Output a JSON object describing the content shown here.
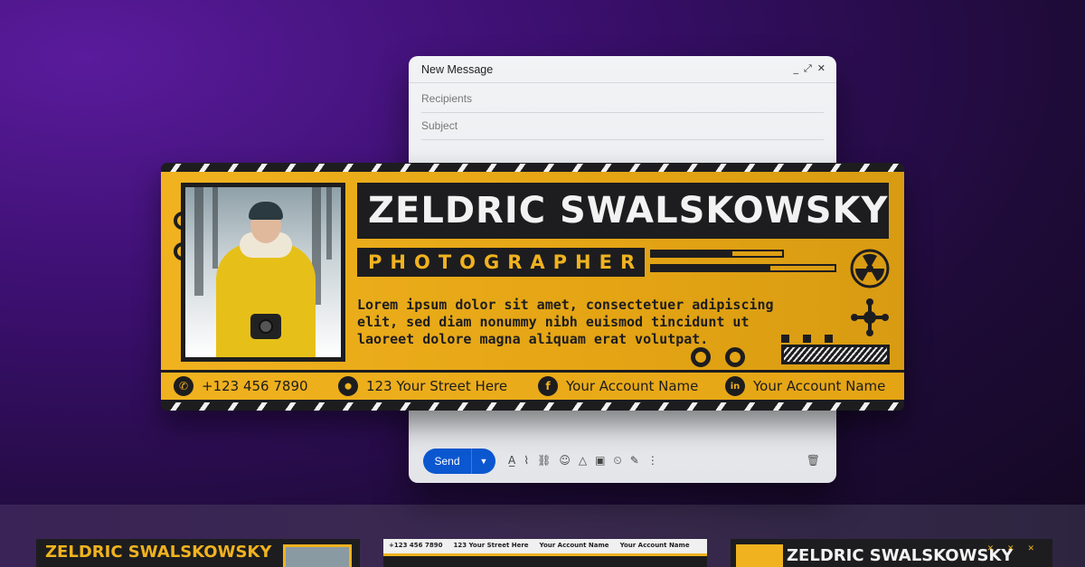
{
  "email": {
    "title": "New Message",
    "controls": [
      "_",
      "⤢",
      "✕"
    ],
    "recipients_placeholder": "Recipients",
    "subject_placeholder": "Subject",
    "send_label": "Send",
    "dropdown_icon": "▼",
    "toolbar_icons": [
      "format-text-icon",
      "attach-icon",
      "link-icon",
      "emoji-icon",
      "drive-icon",
      "image-icon",
      "lock-clock-icon",
      "pen-icon",
      "more-icon"
    ],
    "toolbar_glyphs": [
      "A̲",
      "⌇",
      "⛓",
      "☺",
      "△",
      "▣",
      "⏲",
      "✎",
      "⋮"
    ],
    "trash_glyph": "🗑"
  },
  "signature": {
    "name": "ZELDRIC SWALSKOWSKY",
    "role": "PHOTOGRAPHER",
    "description": "Lorem ipsum dolor sit amet, consectetuer adipiscing elit, sed diam nonummy nibh euismod tincidunt ut laoreet dolore magna aliquam erat volutpat.",
    "bars": [
      0.62,
      0.65
    ],
    "contacts": {
      "phone": "+123 456 7890",
      "address": "123 Your Street Here",
      "facebook": "Your Account Name",
      "linkedin": "Your Account Name"
    },
    "contact_glyphs": {
      "whatsapp": "✆",
      "location": "⬤",
      "facebook": "f",
      "linkedin": "in"
    },
    "colors": {
      "accent": "#f0b21f",
      "dark": "#1d1d1f",
      "light": "#f2f2f2"
    }
  },
  "thumbnails": {
    "first_name": "ZELDRIC SWALSKOWSKY",
    "second_phone": "+123 456 7890",
    "second_address": "123 Your Street Here",
    "second_facebook": "Your Account Name",
    "second_linkedin": "Your Account Name",
    "third_name": "ZELDRIC SWALSKOWSKY",
    "third_icons": "✕ ✕ ✕"
  }
}
